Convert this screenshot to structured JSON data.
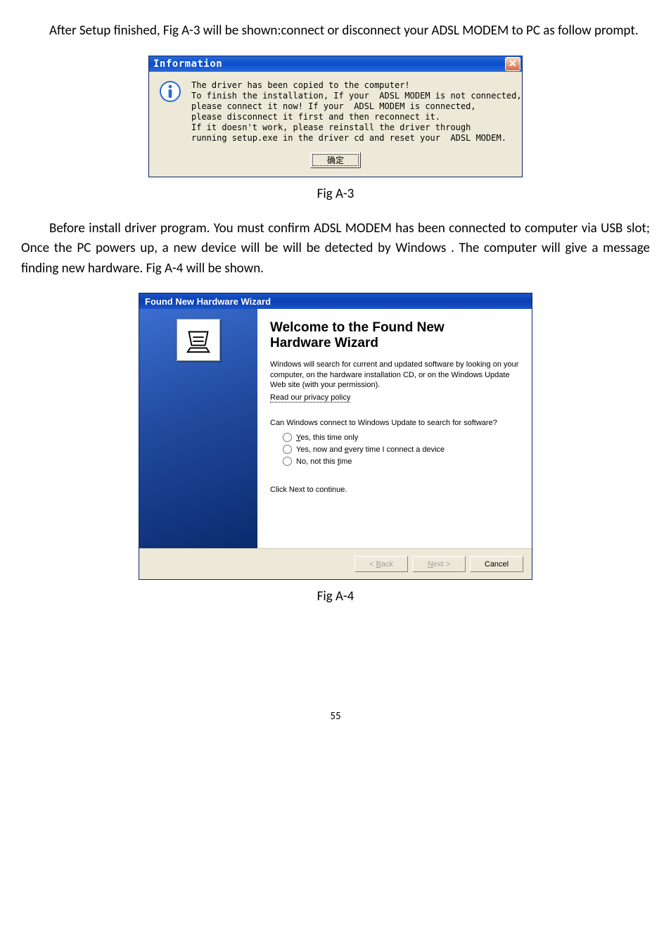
{
  "paragraphs": {
    "p1": "After Setup finished, Fig A-3 will be shown:connect or disconnect your ADSL MODEM to PC as follow prompt.",
    "p2": "Before install driver program. You must confirm ADSL MODEM has been connected to computer via USB slot; Once the PC powers up, a new device will be will be detected by Windows . The computer will give a message finding new hardware. Fig A-4 will be shown."
  },
  "captions": {
    "c1": "Fig A-3",
    "c2": "Fig A-4"
  },
  "info_dialog": {
    "title": "Information",
    "body": "The driver has been copied to the computer!\nTo finish the installation, If your  ADSL MODEM is not connected,\nplease connect it now! If your  ADSL MODEM is connected,\nplease disconnect it first and then reconnect it.\nIf it doesn't work, please reinstall the driver through\nrunning setup.exe in the driver cd and reset your  ADSL MODEM.",
    "ok_label": "确定",
    "close_glyph": "✕"
  },
  "wizard": {
    "title": "Found New Hardware Wizard",
    "heading_line1": "Welcome to the Found New",
    "heading_line2": "Hardware Wizard",
    "search_text": "Windows will search for current and updated software by looking on your computer, on the hardware installation CD, or on the Windows Update Web site (with your permission).",
    "privacy_link": "Read our privacy policy",
    "question": "Can Windows connect to Windows Update to search for software?",
    "radios": {
      "r1_pre": "Y",
      "r1_post": "es, this time only",
      "r2_pre": "Yes, now and ",
      "r2_mid": "e",
      "r2_post": "very time I connect a device",
      "r3_pre": "No, not this ",
      "r3_mid": "t",
      "r3_post": "ime"
    },
    "continue": "Click Next to continue.",
    "buttons": {
      "back_pre": "< ",
      "back_u": "B",
      "back_post": "ack",
      "next_u": "N",
      "next_post": "ext >",
      "cancel": "Cancel"
    }
  },
  "page_number": "55"
}
